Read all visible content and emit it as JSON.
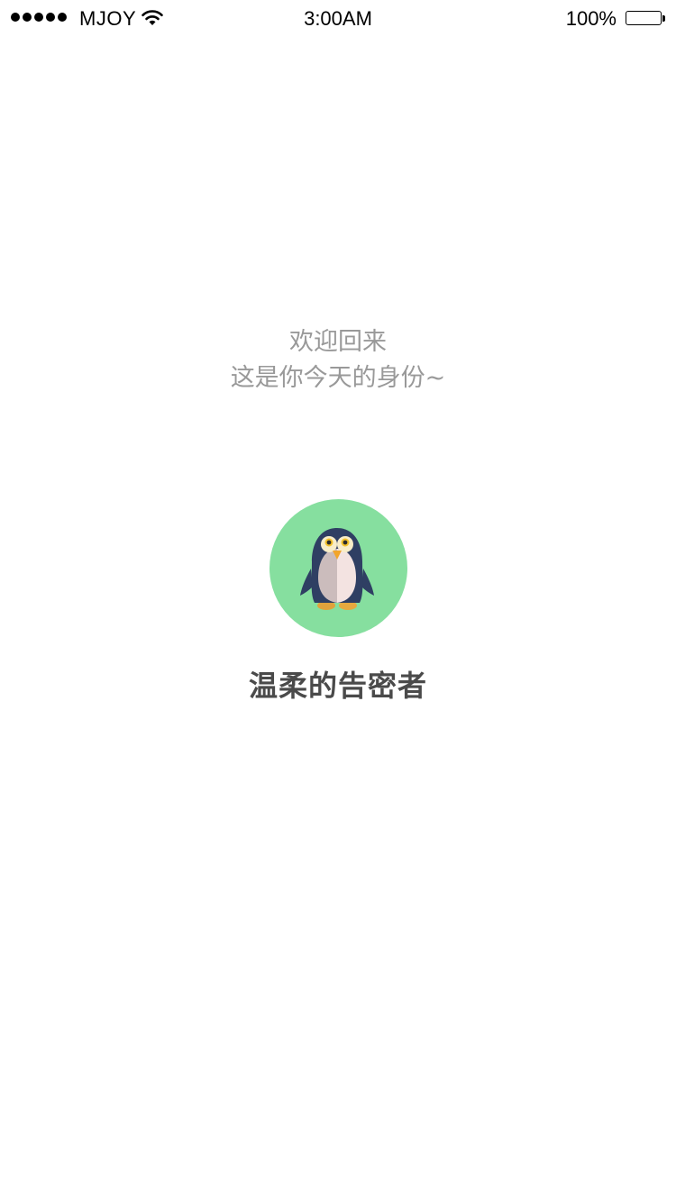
{
  "status_bar": {
    "carrier": "MJOY",
    "time": "3:00AM",
    "battery_percent": "100%",
    "signal_bars": 5,
    "icons": [
      "signal-dots-icon",
      "wifi-icon",
      "battery-icon"
    ]
  },
  "welcome": {
    "line1": "欢迎回来",
    "line2": "这是你今天的身份~"
  },
  "identity": {
    "avatar_icon": "penguin-icon",
    "avatar_bg_color": "#86df9f",
    "name": "温柔的告密者"
  }
}
